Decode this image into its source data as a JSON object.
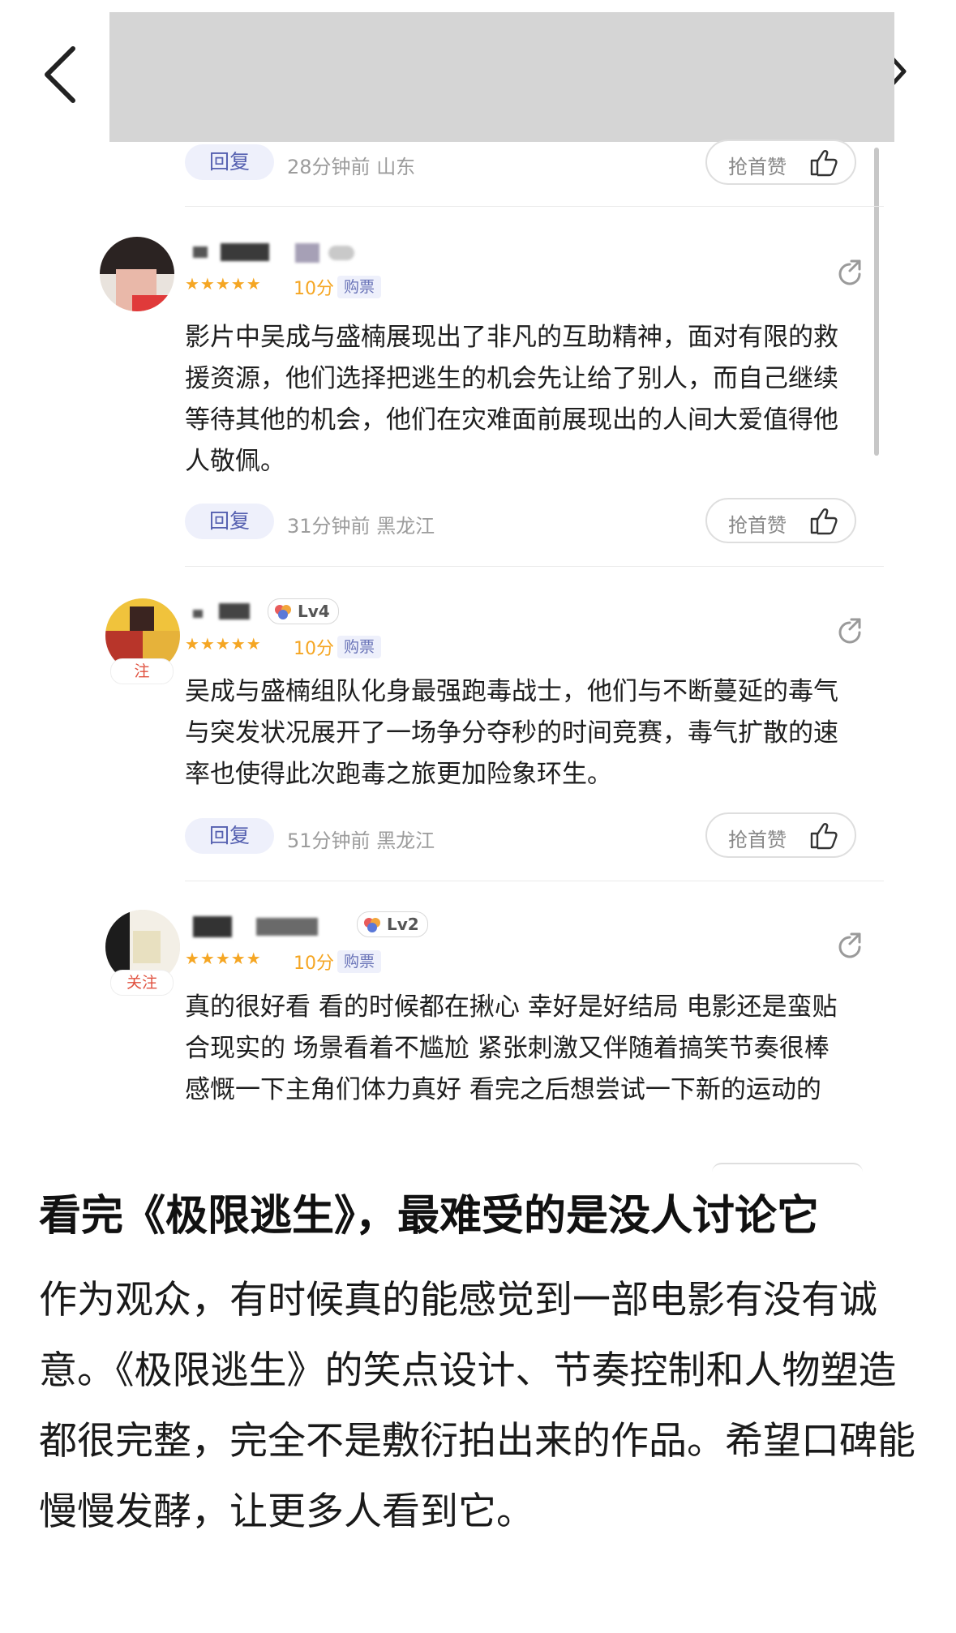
{
  "nav": {
    "back_icon": "chevron-left-icon",
    "forward_icon": "chevron-right-icon"
  },
  "comments": [
    {
      "reply_label": "回复",
      "time": "28分钟前",
      "location": "山东",
      "like_label": "抢首赞"
    },
    {
      "score": "10分",
      "buy_tag": "购票",
      "text": "影片中吴成与盛楠展现出了非凡的互助精神，面对有限的救援资源，他们选择把逃生的机会先让给了别人，而自己继续等待其他的机会，他们在灾难面前展现出的人间大爱值得他人敬佩。",
      "reply_label": "回复",
      "time": "31分钟前",
      "location": "黑龙江",
      "like_label": "抢首赞"
    },
    {
      "level": "Lv4",
      "follow_label": "注",
      "score": "10分",
      "buy_tag": "购票",
      "text": "吴成与盛楠组队化身最强跑毒战士，他们与不断蔓延的毒气与突发状况展开了一场争分夺秒的时间竞赛，毒气扩散的速率也使得此次跑毒之旅更加险象环生。",
      "reply_label": "回复",
      "time": "51分钟前",
      "location": "黑龙江",
      "like_label": "抢首赞"
    },
    {
      "level": "Lv2",
      "follow_label": "关注",
      "score": "10分",
      "buy_tag": "购票",
      "text": "真的很好看 看的时候都在揪心 幸好是好结局 电影还是蛮贴合现实的 场景看着不尴尬 紧张刺激又伴随着搞笑节奏很棒 感慨一下主角们体力真好 看完之后想尝试一下新的运动的"
    }
  ],
  "article": {
    "title": "看完《极限逃生》，最难受的是没人讨论它",
    "body": "作为观众，有时候真的能感觉到一部电影有没有诚意。《极限逃生》的笑点设计、节奏控制和人物塑造都很完整，完全不是敷衍拍出来的作品。希望口碑能慢慢发酵，让更多人看到它。"
  },
  "colors": {
    "accent": "#5560b0",
    "star": "#f5a623",
    "follow": "#e0513f"
  }
}
